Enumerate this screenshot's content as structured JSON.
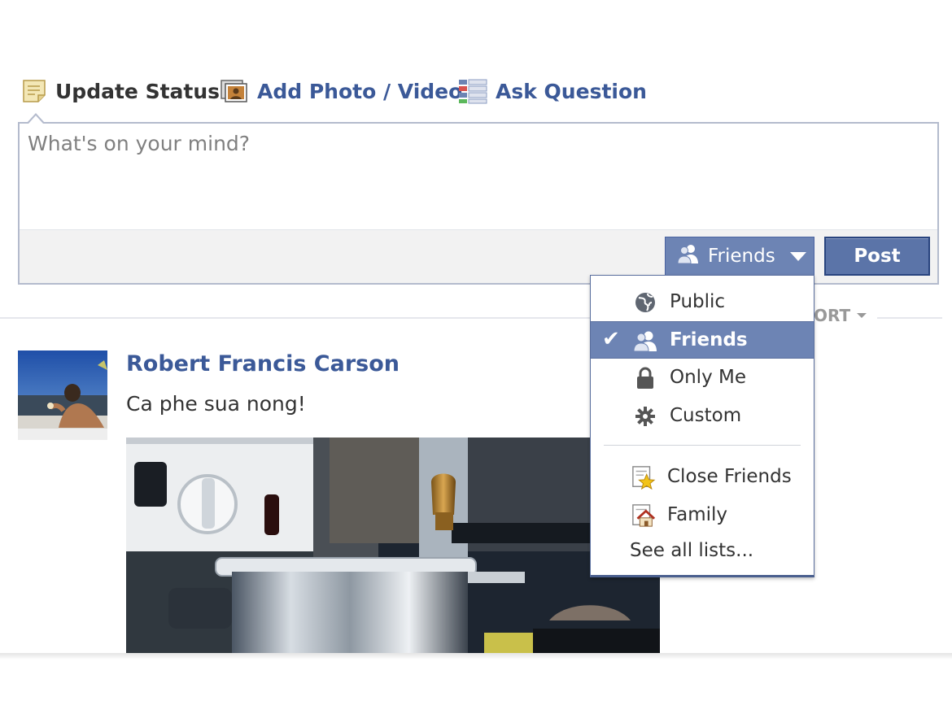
{
  "composer": {
    "tabs": [
      {
        "label": "Update Status",
        "icon": "status-note-icon"
      },
      {
        "label": "Add Photo / Video",
        "icon": "photo-video-icon"
      },
      {
        "label": "Ask Question",
        "icon": "question-list-icon"
      }
    ],
    "placeholder": "What's on your mind?",
    "audience_label": "Friends",
    "post_label": "Post"
  },
  "sort": {
    "label": "ORT"
  },
  "story": {
    "author": "Robert Francis Carson",
    "message": "Ca phe sua nong!"
  },
  "privacy_menu": {
    "items": [
      {
        "label": "Public",
        "icon": "globe-icon",
        "selected": false
      },
      {
        "label": "Friends",
        "icon": "friends-icon",
        "selected": true
      },
      {
        "label": "Only Me",
        "icon": "lock-icon",
        "selected": false
      },
      {
        "label": "Custom",
        "icon": "gear-icon",
        "selected": false
      }
    ],
    "lists": [
      {
        "label": "Close Friends",
        "icon": "close-friends-star-icon"
      },
      {
        "label": "Family",
        "icon": "family-house-icon"
      }
    ],
    "see_all_label": "See all lists..."
  },
  "colors": {
    "link_blue": "#3b5998",
    "button_blue": "#6d84b4",
    "post_button": "#5b74a8",
    "footer_gray": "#f2f2f2"
  }
}
